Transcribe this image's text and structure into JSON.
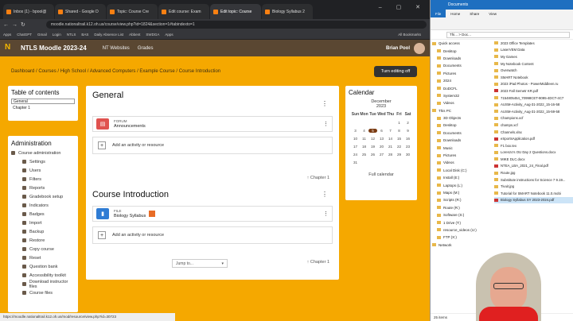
{
  "browser": {
    "tabs": [
      "Inbox (1) - bpool@",
      "Shared - Google D",
      "Topic: Course Cre",
      "Edit course: Exam",
      "Edit topic: Course",
      "Biology Syllabus 2"
    ],
    "url": "moodle.nationaltrail.k12.oh.us/course/view.php?id=1824&section=1#tabindexto=1",
    "bookmarks": [
      "Apps",
      "ChatGPT",
      "Gmail",
      "Login",
      "NTLS",
      "BAS",
      "Daily Absence List",
      "Abbent",
      "SWDGA",
      "Apps",
      "All Bookmarks"
    ]
  },
  "moodle": {
    "site_name": "NTLS Moodle 2023-24",
    "menu": [
      "NT Websites",
      "Grades"
    ],
    "user": "Brian Pool",
    "breadcrumbs": "Dashboard / Courses / High School / Advanced Computers / Example Course / Course Introduction",
    "turn_editing": "Turn editing off",
    "toc": {
      "title": "Table of contents",
      "selected": "General",
      "second": "Chapter 1"
    },
    "admin": {
      "title": "Administration",
      "items": [
        "Course administration",
        "Settings",
        "Users",
        "Filters",
        "Reports",
        "Gradebook setup",
        "Indicators",
        "Badges",
        "Import",
        "Backup",
        "Restore",
        "Copy course",
        "Reset",
        "Question bank",
        "Accessibility toolkit",
        "Download instructor files",
        "Course files"
      ]
    },
    "general": {
      "title": "General",
      "activity_label": "FORUM",
      "activity_name": "Announcements",
      "add": "Add an activity or resource",
      "chapter_link": "Chapter 1"
    },
    "intro": {
      "title": "Course Introduction",
      "activity_label": "FILE",
      "activity_name": "Biology Syllabus",
      "add": "Add an activity or resource",
      "jump": "Jump to...",
      "chapter_link": "Chapter 1"
    },
    "calendar": {
      "title": "Calendar",
      "month": "December",
      "year": "2023",
      "days": [
        "Sun",
        "Mon",
        "Tue",
        "Wed",
        "Thu",
        "Fri",
        "Sat"
      ],
      "weeks": [
        [
          "",
          "",
          "",
          "",
          "",
          "1",
          "2"
        ],
        [
          "3",
          "4",
          "5",
          "6",
          "7",
          "8",
          "9"
        ],
        [
          "10",
          "11",
          "12",
          "13",
          "14",
          "15",
          "16"
        ],
        [
          "17",
          "18",
          "19",
          "20",
          "21",
          "22",
          "23"
        ],
        [
          "24",
          "25",
          "26",
          "27",
          "28",
          "29",
          "30"
        ],
        [
          "31",
          "",
          "",
          "",
          "",
          "",
          ""
        ]
      ],
      "today": "5",
      "full": "Full calendar"
    },
    "status_url": "https://moodle.nationaltrail.k12.oh.us/mod/resource/view.php?id=30723"
  },
  "explorer": {
    "title": "Documents",
    "tabs": [
      "File",
      "Home",
      "Share",
      "View"
    ],
    "path": "Thi... > Doc...",
    "nav": [
      "Quick access",
      "Desktop",
      "Downloads",
      "Documents",
      "Pictures",
      "2024",
      "DoDCFL",
      "System32",
      "Videos",
      "This PC",
      "3D Objects",
      "Desktop",
      "Documents",
      "Downloads",
      "Music",
      "Pictures",
      "Videos",
      "Local Disk (C:)",
      "Install (E:)",
      "Laptops (L:)",
      "Maps (M:)",
      "Scripts (R:)",
      "Route (R:)",
      "Software (S:)",
      "1 Drive (T:)",
      "resource_videos (U:)",
      "FTP (X:)",
      "Network"
    ],
    "files": [
      "2023 Office Templates",
      "LaserVEM Data",
      "My Games",
      "My Notebook Content",
      "Overwatch",
      "SMART Notebook",
      "2023 iPad Photos - PowerMiddleen.ru",
      "2023 Fall Semetr KR.pdf",
      "7154805454_70998CET-9095-4DCT-4C7",
      "AUSM-Activity_Aug-31-2022_15-16-58",
      "AUSM-Activity_Aug-31-2022_15-59-58",
      "Champions.xcf",
      "champs.xcf",
      "Channels.xlsx",
      "eSportsApplication.pdf",
      "F1 box.tex",
      "Lorenzo's OU Day 2 Questions.docx",
      "MIKE DLC.docx",
      "NTEA_LBA_2021_24_Final.pdf",
      "Route.jpg",
      "Substitute instructions for Science 7 9.19...",
      "Tivuit.jpg",
      "Tutorial for SMART Notebook 11.0.mobi",
      "Biology Syllabus SY 2023-2024.pdf"
    ],
    "status": "25 items"
  },
  "colors": {
    "moodle_orange": "#f5a800",
    "navbar": "#5a4732",
    "forum": "#e0524f",
    "file": "#2f7cd4"
  }
}
